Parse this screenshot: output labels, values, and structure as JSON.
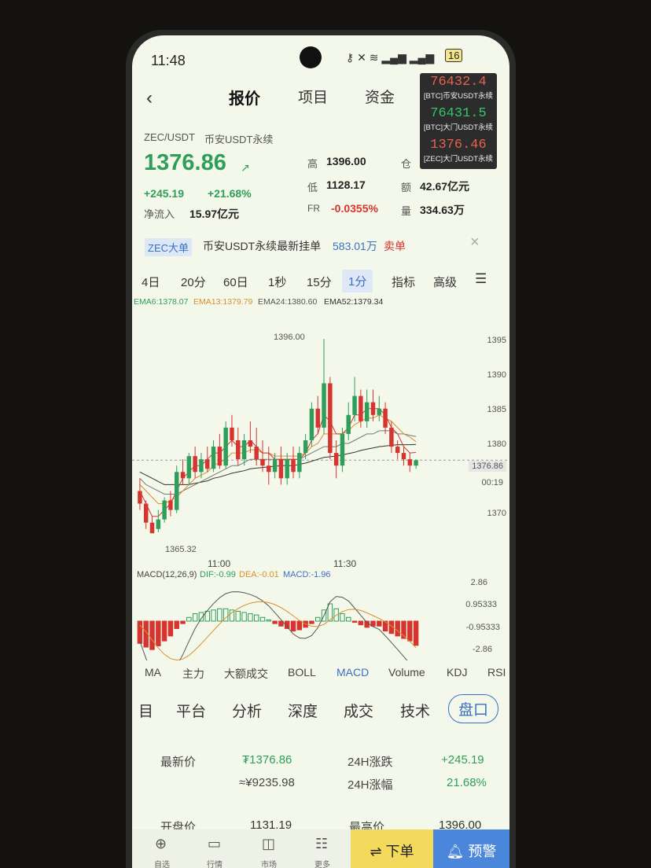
{
  "status": {
    "time": "11:48",
    "battery": "16"
  },
  "nav": {
    "tabs": [
      "报价",
      "项目",
      "资金"
    ]
  },
  "ticker": {
    "pair": "ZEC/USDT",
    "market": "币安USDT永续",
    "price": "1376.86",
    "change": "+245.19",
    "change_pct": "+21.68%",
    "netflow_label": "净流入",
    "netflow": "15.97亿元"
  },
  "stats": {
    "high_label": "高",
    "high": "1396.00",
    "low_label": "低",
    "low": "1128.17",
    "fr_label": "FR",
    "fr": "-0.0355%",
    "oi_label": "仓",
    "amount_label": "额",
    "amount": "42.67亿元",
    "vol_label": "量",
    "vol": "334.63万"
  },
  "overlay": [
    {
      "price": "76432.4",
      "label": "[BTC]币安USDT永续",
      "color": "#e8614f"
    },
    {
      "price": "76431.5",
      "label": "[BTC]大门USDT永续",
      "color": "#34c36a"
    },
    {
      "price": "1376.46",
      "label": "[ZEC]大门USDT永续",
      "color": "#e8614f"
    }
  ],
  "banner": {
    "tag": "ZEC大单",
    "text": "币安USDT永续最新挂单",
    "amount": "583.01万",
    "side": "卖单"
  },
  "timeframes": [
    "4日",
    "20分",
    "60日",
    "1秒",
    "15分",
    "1分",
    "指标",
    "高级"
  ],
  "ema": [
    {
      "label": "EMA6:1378.07",
      "color": "#2e9e5a"
    },
    {
      "label": "EMA13:1379.79",
      "color": "#d98e2b"
    },
    {
      "label": "EMA24:1380.60",
      "color": "#555555"
    },
    {
      "label": "EMA52:1379.34",
      "color": "#333333"
    }
  ],
  "chart": {
    "y_labels": [
      "1395",
      "1390",
      "1385",
      "1380",
      "1376.86",
      "1370"
    ],
    "countdown": "00:19",
    "max_label": "1396.00",
    "min_label": "1365.32",
    "x_labels": [
      "11:00",
      "11:30"
    ]
  },
  "macd": {
    "header": "MACD(12,26,9)",
    "dif": "DIF:-0.99",
    "dea": "DEA:-0.01",
    "macd": "MACD:-1.96",
    "y_labels": [
      "2.86",
      "0.95333",
      "-0.95333",
      "-2.86"
    ]
  },
  "indicators": [
    "MA",
    "主力",
    "大额成交",
    "BOLL",
    "MACD",
    "Volume",
    "KDJ",
    "RSI"
  ],
  "sections": [
    "目",
    "平台",
    "分析",
    "深度",
    "成交",
    "技术",
    "盘口"
  ],
  "info": {
    "latest_label": "最新价",
    "latest_val": "₮1376.86",
    "latest_cny": "≈¥9235.98",
    "chg_label": "24H涨跌",
    "chg_val": "+245.19",
    "pct_label": "24H涨幅",
    "pct_val": "21.68%",
    "open_label": "开盘价",
    "open_val": "1131.19",
    "high_label": "最高价",
    "high_val": "1396.00"
  },
  "bottom": {
    "items": [
      "自选",
      "行情",
      "市场",
      "更多"
    ],
    "order": "⇌ 下单",
    "alert": "预警"
  },
  "chart_data": {
    "type": "candlestick",
    "x_labels": [
      "11:00",
      "11:30"
    ],
    "ylim": [
      1362,
      1398
    ],
    "candles": [
      [
        1372,
        1374,
        1370,
        1369
      ],
      [
        1370,
        1370.5,
        1367,
        1366
      ],
      [
        1367,
        1368,
        1365.32,
        1366
      ],
      [
        1366,
        1369,
        1367.5,
        1365.5
      ],
      [
        1367.5,
        1371,
        1370.5,
        1367
      ],
      [
        1370.5,
        1372,
        1369,
        1368
      ],
      [
        1369,
        1376,
        1375,
        1368.5
      ],
      [
        1375,
        1377,
        1374,
        1373
      ],
      [
        1374,
        1378,
        1377.5,
        1373
      ],
      [
        1377.5,
        1379,
        1375,
        1374
      ],
      [
        1375,
        1378,
        1377,
        1374
      ],
      [
        1377,
        1379,
        1375.5,
        1375
      ],
      [
        1375.5,
        1380,
        1379,
        1375
      ],
      [
        1379,
        1381,
        1376,
        1375.5
      ],
      [
        1376,
        1383,
        1382,
        1375.5
      ],
      [
        1382,
        1384,
        1380,
        1379
      ],
      [
        1380,
        1382,
        1377,
        1376
      ],
      [
        1377,
        1381,
        1380,
        1376
      ],
      [
        1380,
        1383,
        1379,
        1378
      ],
      [
        1379,
        1382,
        1377,
        1376
      ],
      [
        1377,
        1380,
        1376,
        1375
      ],
      [
        1376,
        1379,
        1375,
        1373
      ],
      [
        1375,
        1378,
        1377,
        1374
      ],
      [
        1377,
        1379,
        1374,
        1373
      ],
      [
        1374,
        1378,
        1377,
        1373
      ],
      [
        1377,
        1379,
        1375,
        1374
      ],
      [
        1375,
        1379,
        1378,
        1374
      ],
      [
        1378,
        1381,
        1380,
        1377
      ],
      [
        1380,
        1386,
        1385,
        1379
      ],
      [
        1385,
        1387,
        1382,
        1381
      ],
      [
        1382,
        1396,
        1389,
        1381
      ],
      [
        1389,
        1390,
        1378,
        1377
      ],
      [
        1378,
        1380,
        1376,
        1374
      ],
      [
        1376,
        1382,
        1381,
        1375
      ],
      [
        1381,
        1386,
        1384,
        1380
      ],
      [
        1384,
        1390,
        1387,
        1383
      ],
      [
        1387,
        1388,
        1383,
        1382
      ],
      [
        1383,
        1388,
        1386,
        1382
      ],
      [
        1386,
        1388,
        1384,
        1383
      ],
      [
        1384,
        1387,
        1385,
        1383
      ],
      [
        1385,
        1386,
        1382,
        1381
      ],
      [
        1382,
        1383,
        1379,
        1378
      ],
      [
        1379,
        1380,
        1378,
        1377
      ],
      [
        1378,
        1379,
        1377,
        1376
      ],
      [
        1377,
        1378,
        1376,
        1375
      ],
      [
        1376,
        1377,
        1376.86,
        1375.5
      ]
    ],
    "ema6": [
      1372,
      1370,
      1368,
      1368,
      1369,
      1370,
      1372,
      1374,
      1375,
      1376,
      1376,
      1377,
      1378,
      1378,
      1379,
      1380,
      1379,
      1379,
      1380,
      1379,
      1378,
      1378,
      1377,
      1377,
      1377,
      1377,
      1377,
      1378,
      1380,
      1381,
      1384,
      1383,
      1381,
      1381,
      1382,
      1384,
      1384,
      1385,
      1385,
      1385,
      1384,
      1382,
      1381,
      1379,
      1378,
      1378.07
    ],
    "ema13": [
      1373,
      1372,
      1371,
      1370,
      1370,
      1370.5,
      1371,
      1372,
      1373,
      1374,
      1374.5,
      1375,
      1376,
      1376.5,
      1377,
      1378,
      1378,
      1378,
      1378.5,
      1378.5,
      1378,
      1378,
      1377.5,
      1377.5,
      1377.5,
      1377.5,
      1377.5,
      1378,
      1379,
      1379.5,
      1381,
      1381,
      1381,
      1381,
      1381.5,
      1382.5,
      1383,
      1383.5,
      1383.5,
      1384,
      1383.5,
      1383,
      1382,
      1381,
      1380.5,
      1379.79
    ],
    "ema24": [
      1374,
      1373,
      1372.5,
      1372,
      1371.5,
      1371.5,
      1371.5,
      1372,
      1372.5,
      1373,
      1373.5,
      1374,
      1374.5,
      1375,
      1375.5,
      1376,
      1376,
      1376.5,
      1377,
      1377,
      1377,
      1377,
      1377,
      1377,
      1377,
      1377,
      1377,
      1377.5,
      1378,
      1378.5,
      1379,
      1379,
      1379,
      1379.5,
      1379.5,
      1380,
      1380.5,
      1381,
      1381,
      1381.5,
      1381.5,
      1381.5,
      1381,
      1381,
      1380.8,
      1380.6
    ],
    "ema52": [
      1375,
      1374.5,
      1374,
      1373.5,
      1373,
      1373,
      1373,
      1373,
      1373,
      1373.2,
      1373.4,
      1373.6,
      1374,
      1374.2,
      1374.5,
      1374.8,
      1375,
      1375.2,
      1375.5,
      1375.6,
      1375.7,
      1375.8,
      1375.9,
      1376,
      1376,
      1376,
      1376.2,
      1376.4,
      1376.7,
      1377,
      1377.3,
      1377.4,
      1377.5,
      1377.7,
      1377.9,
      1378.1,
      1378.4,
      1378.6,
      1378.8,
      1379,
      1379.1,
      1379.2,
      1379.3,
      1379.3,
      1379.3,
      1379.34
    ],
    "macd_hist": [
      -1.8,
      -2.1,
      -2.3,
      -2.0,
      -1.6,
      -1.2,
      -0.6,
      -0.2,
      0.3,
      0.6,
      0.7,
      0.8,
      0.9,
      1.0,
      1.0,
      0.9,
      0.8,
      0.7,
      0.6,
      0.5,
      0.3,
      0.1,
      -0.2,
      -0.4,
      -0.6,
      -0.8,
      -0.7,
      -0.5,
      -0.2,
      0.3,
      0.9,
      1.4,
      1.0,
      0.6,
      0.3,
      -0.1,
      -0.3,
      -0.5,
      -0.4,
      -0.4,
      -0.8,
      -1.0,
      -1.2,
      -1.4,
      -1.6,
      -1.96
    ],
    "macd_ylim": [
      -2.86,
      2.86
    ]
  }
}
